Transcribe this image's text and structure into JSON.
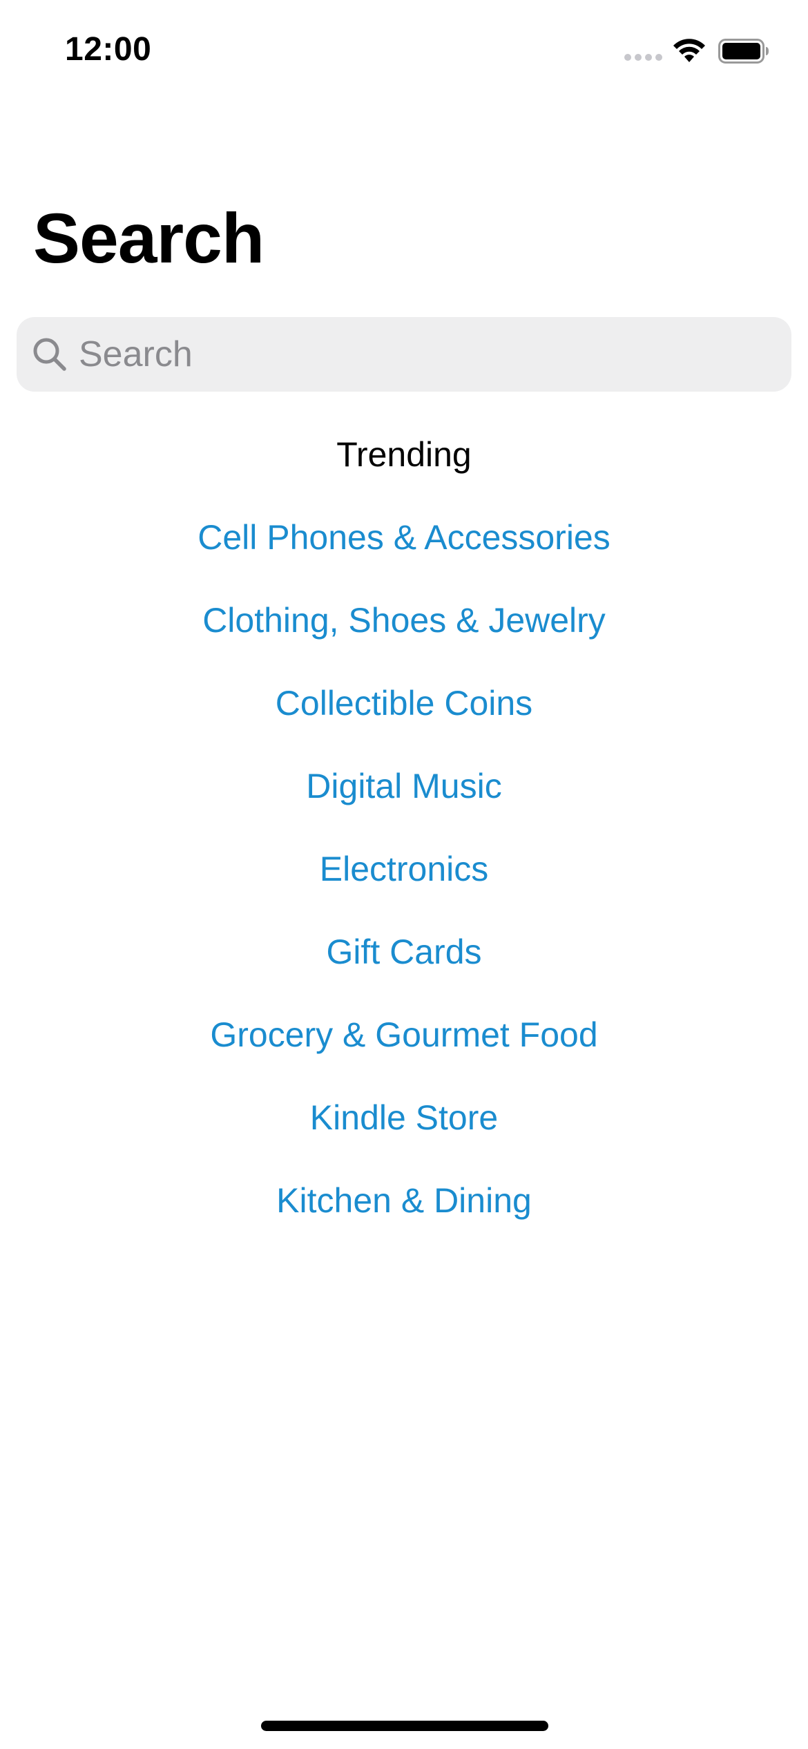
{
  "status_bar": {
    "time": "12:00"
  },
  "page": {
    "title": "Search"
  },
  "search": {
    "placeholder": "Search",
    "value": ""
  },
  "trending": {
    "heading": "Trending",
    "items": [
      {
        "label": "Cell Phones & Accessories"
      },
      {
        "label": "Clothing, Shoes & Jewelry"
      },
      {
        "label": "Collectible Coins"
      },
      {
        "label": "Digital Music"
      },
      {
        "label": "Electronics"
      },
      {
        "label": "Gift Cards"
      },
      {
        "label": "Grocery & Gourmet Food"
      },
      {
        "label": "Kindle Store"
      },
      {
        "label": "Kitchen & Dining"
      }
    ]
  },
  "colors": {
    "link": "#1a8ccf",
    "search_background": "#eeeeef",
    "placeholder": "#8a8a8e",
    "text": "#000000"
  },
  "icons": {
    "search": "search-icon",
    "wifi": "wifi-icon",
    "battery": "battery-icon",
    "signal": "cellular-signal-icon"
  }
}
